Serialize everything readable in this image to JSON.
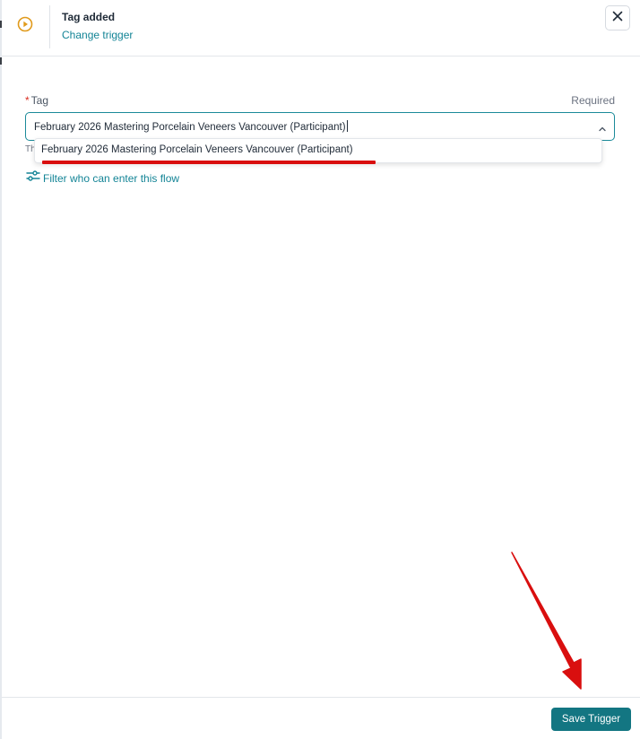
{
  "header": {
    "title": "Tag added",
    "change_link": "Change trigger",
    "trigger_icon": "play-circle-icon",
    "close_icon": "close-icon"
  },
  "form": {
    "tag_label": "Tag",
    "required_hint": "Required",
    "tag_value": "February 2026 Mastering Porcelain Veneers Vancouver (Participant)",
    "helper_text": "Th",
    "dropdown_options": [
      "February 2026 Mastering Porcelain Veneers Vancouver (Participant)"
    ],
    "filter_link": "Filter who can enter this flow",
    "filter_icon": "sliders-icon"
  },
  "footer": {
    "save_label": "Save Trigger"
  },
  "colors": {
    "accent": "#138496",
    "primary_button": "#137682",
    "trigger_icon": "#e09a1b",
    "annotation": "#d90f0f"
  }
}
